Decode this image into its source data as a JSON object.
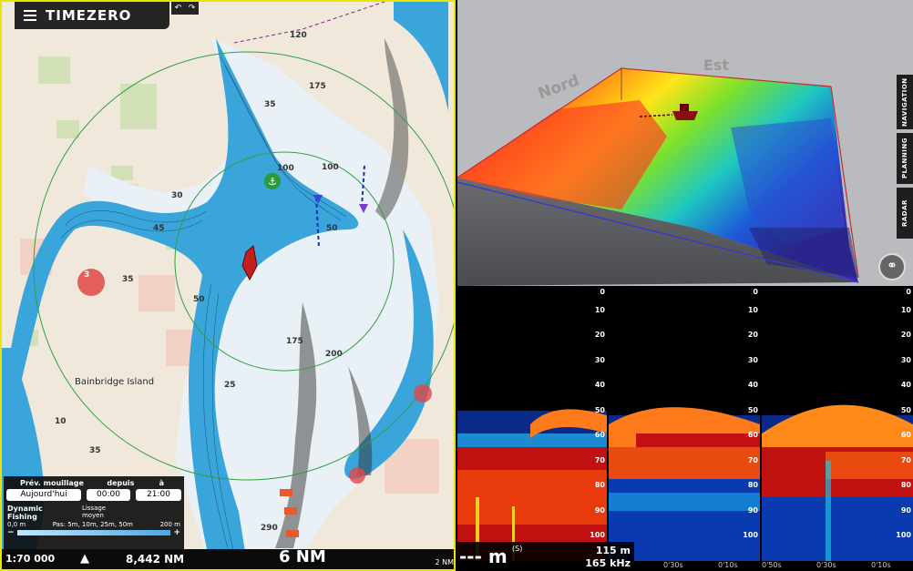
{
  "app": {
    "logo": "TIMEZERO",
    "undo": "↶",
    "redo": "↷"
  },
  "chart": {
    "place_label": "Bainbridge Island",
    "depths": [
      "120",
      "175",
      "35",
      "100",
      "50",
      "45",
      "35",
      "50",
      "175",
      "200",
      "25",
      "290",
      "100",
      "30",
      "10",
      "35"
    ],
    "markers": [
      "3"
    ]
  },
  "anchor_panel": {
    "head_prev": "Prév. mouillage",
    "head_since": "depuis",
    "head_to": "à",
    "value_prev": "Aujourd'hui",
    "value_since": "00:00",
    "value_to": "21:00",
    "fishing_title": "Dynamic Fishing",
    "smoothing_label": "Lissage moyen",
    "scale_min": "0,0 m",
    "scale_step": "Pas: 5m, 10m, 25m, 50m",
    "scale_max": "200 m",
    "minus": "−",
    "plus": "+"
  },
  "bottom_bar": {
    "scale": "1:70 000",
    "north": "▲",
    "range": "8,442 NM",
    "zoom": "6 NM",
    "corner_range": "2 NM"
  },
  "three_d": {
    "label_north": "Nord",
    "label_east": "Est",
    "tabs": [
      "NAVIGATION",
      "PLANNING",
      "RADAR"
    ]
  },
  "sonar": {
    "depth_display": "--- m",
    "depth_sup": "(S)",
    "depth_value": "115 m",
    "frequency": "165 kHz",
    "scale_ticks": [
      "0",
      "10",
      "20",
      "30",
      "40",
      "50",
      "60",
      "70",
      "80",
      "90",
      "100"
    ],
    "time_labels": [
      "0'30s",
      "0'10s",
      "0'30s",
      "0'50s",
      "0'10s"
    ]
  },
  "colors": {
    "frame_yellow": "#e6e600",
    "water_deep": "#2f9fd6",
    "land": "#f3ece2",
    "toolbar": "#141414"
  }
}
